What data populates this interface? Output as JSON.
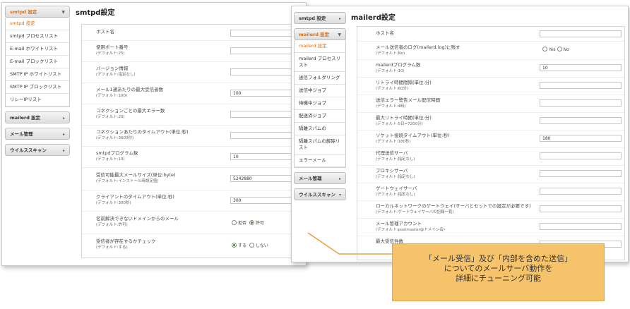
{
  "colors": {
    "accent": "#d9721c",
    "callout_bg": "#f7c36a",
    "callout_line": "#e8a040"
  },
  "left": {
    "sidebar": {
      "active_group": "smtpd 設定",
      "items": [
        "smtpd 設定",
        "smtpd プロセスリスト",
        "E-mail ホワイトリスト",
        "E-mail ブロックリスト",
        "SMTP IP ホワイトリスト",
        "SMTP IP ブロックリスト",
        "リレーIPリスト"
      ],
      "groups": [
        "mailerd 設定",
        "メール管理",
        "ウイルススキャン"
      ]
    },
    "title": "smtpd設定",
    "fields": [
      {
        "label": "ホスト名",
        "sub": "",
        "value": ""
      },
      {
        "label": "使用ポート番号",
        "sub": "(デフォルト:25)",
        "value": ""
      },
      {
        "label": "バージョン情報",
        "sub": "(デフォルト:指定なし)",
        "value": ""
      },
      {
        "label": "メール1通あたりの最大受信者数",
        "sub": "(デフォルト:100)",
        "value": "100"
      },
      {
        "label": "コネクションごとの最大エラー数",
        "sub": "(デフォルト:20)",
        "value": ""
      },
      {
        "label": "コネクションあたりのタイムアウト(単位:秒)",
        "sub": "(デフォルト:3600秒)",
        "value": ""
      },
      {
        "label": "smtpdプログラム数",
        "sub": "(デフォルト:10)",
        "value": "10"
      },
      {
        "label": "受信可能最大メールサイズ(単位:byte)",
        "sub": "(デフォルト:インストール時設定値)",
        "value": "5242880"
      },
      {
        "label": "クライアントのタイムアウト(単位:秒)",
        "sub": "(デフォルト:300秒)",
        "value": "300"
      },
      {
        "label": "名前解決できないドメインからのメール",
        "sub": "(デフォルト:許可)",
        "options": [
          "拒否",
          "許可"
        ],
        "selected": 1
      },
      {
        "label": "受信者が存在するかチェック",
        "sub": "(デフォルト:する)",
        "options": [
          "する",
          "しない"
        ],
        "selected": 0
      }
    ]
  },
  "right": {
    "sidebar": {
      "top_group": "smtpd 設定",
      "active_group": "mailerd 設定",
      "items": [
        "mailerd 設定",
        "mailerd プロセスリスト",
        "送信フォルダリング",
        "送信中ジョブ",
        "待機中ジョブ",
        "配送済ジョブ",
        "隔離スパムの",
        "隔離スパムの解除リスト",
        "エラーメール"
      ],
      "groups": [
        "メール管理",
        "ウイルススキャン"
      ]
    },
    "title": "mailerd設定",
    "fields": [
      {
        "label": "ホスト名",
        "sub": "",
        "value": ""
      },
      {
        "label": "メール送信者のログ(mailerd.log)に残す",
        "sub": "(デフォルト:No)",
        "options": [
          "Yes",
          "No"
        ],
        "selected": -1
      },
      {
        "label": "mailerdプログラム数",
        "sub": "(デフォルト:10)",
        "value": "10"
      },
      {
        "label": "リトライ時間間隔(単位:分)",
        "sub": "(デフォルト:60分)",
        "value": ""
      },
      {
        "label": "送信エラー警告メール配信時間",
        "sub": "(デフォルト:4時)",
        "value": ""
      },
      {
        "label": "最大リトライ時間(単位:分)",
        "sub": "(デフォルト:5日=7200分)",
        "value": ""
      },
      {
        "label": "ソケット接続タイムアウト(単位:秒)",
        "sub": "(デフォルト:180秒)",
        "value": "180"
      },
      {
        "label": "代理送信サーバ",
        "sub": "(デフォルト:指定なし)",
        "value": ""
      },
      {
        "label": "プロキシサーバ",
        "sub": "(デフォルト:指定なし)",
        "value": ""
      },
      {
        "label": "ゲートウェイサーバ",
        "sub": "(デフォルト:指定なし)",
        "value": ""
      },
      {
        "label": "ローカルネットワークのゲートウェイ(サーバとセットでの設定が必要です)",
        "sub": "(デフォルト:ゲートウェイサーバの記録一覧)",
        "value": ""
      },
      {
        "label": "メール管理アカウント",
        "sub": "(デフォルト:postmaster@ドメイン名)",
        "value": ""
      },
      {
        "label": "最大受信件数",
        "sub": "",
        "value": ""
      }
    ]
  },
  "callout": {
    "line1": "「メール受信」及び「内部を含めた送信」",
    "line2": "についてのメールサーバ動作を",
    "line3": "詳細にチューニング可能"
  }
}
